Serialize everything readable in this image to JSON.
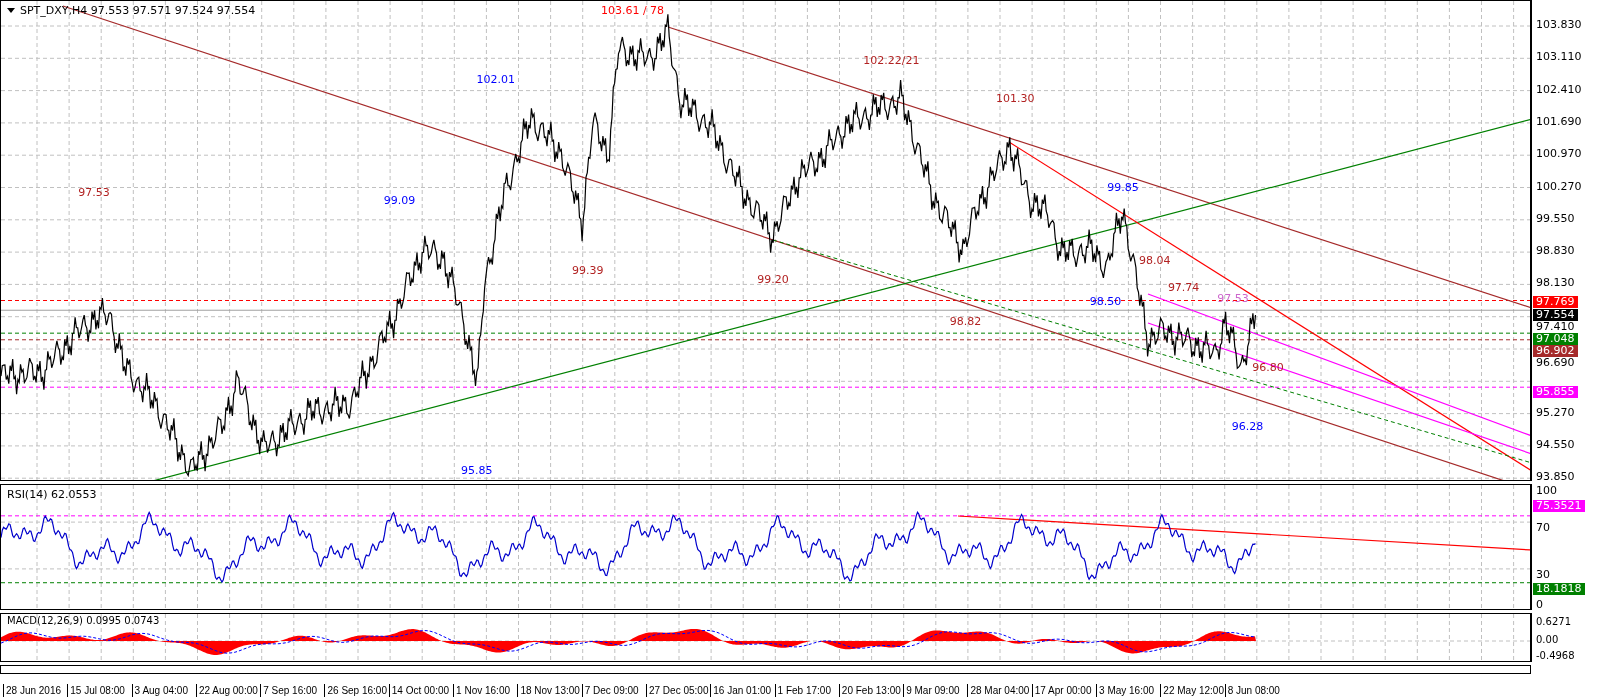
{
  "chart": {
    "title": "SPT_DXY,H4 97.553 97.571 97.524 97.554",
    "annotations": [
      {
        "text": "103.61 / 78",
        "color": "#ff0000"
      },
      {
        "text": "102.22/21",
        "color": "#b22222"
      },
      {
        "text": "102.01",
        "color": "#0000ff"
      },
      {
        "text": "101.30",
        "color": "#b22222"
      },
      {
        "text": "99.85",
        "color": "#0000ff"
      },
      {
        "text": "97.53",
        "color": "#b22222"
      },
      {
        "text": "99.09",
        "color": "#0000ff"
      },
      {
        "text": "98.04",
        "color": "#b22222"
      },
      {
        "text": "99.39",
        "color": "#b22222"
      },
      {
        "text": "99.20",
        "color": "#b22222"
      },
      {
        "text": "97.74",
        "color": "#b22222"
      },
      {
        "text": "97.53",
        "color": "#cc66cc"
      },
      {
        "text": "98.50",
        "color": "#0000ff"
      },
      {
        "text": "98.82",
        "color": "#b22222"
      },
      {
        "text": "96.80",
        "color": "#b22222"
      },
      {
        "text": "96.28",
        "color": "#0000ff"
      },
      {
        "text": "95.85",
        "color": "#0000ff"
      }
    ]
  },
  "price_axis": {
    "ticks": [
      "103.830",
      "103.110",
      "102.410",
      "101.690",
      "100.970",
      "100.270",
      "99.550",
      "98.830",
      "98.130",
      "97.410",
      "96.690",
      "95.270",
      "94.550",
      "93.850"
    ],
    "tags": [
      {
        "text": "97.769",
        "color": "#ff0000"
      },
      {
        "text": "97.554",
        "color": "#000000"
      },
      {
        "text": "97.048",
        "color": "#008000"
      },
      {
        "text": "96.902",
        "color": "#a52a2a"
      },
      {
        "text": "95.855",
        "color": "#ff00ff"
      }
    ]
  },
  "rsi": {
    "label": "RSI(14) 62.0553",
    "ticks": [
      "100",
      "70",
      "30",
      "0"
    ],
    "tags": [
      {
        "text": "75.3521",
        "color": "#ff00ff"
      },
      {
        "text": "18.1818",
        "color": "#008000"
      }
    ]
  },
  "macd": {
    "label": "MACD(12,26,9) 0.0995 0.0743",
    "ticks": [
      "0.6271",
      "0.00",
      "-0.4968"
    ]
  },
  "time_axis": {
    "labels": [
      "28 Jun 2016",
      "15 Jul 08:00",
      "3 Aug 04:00",
      "22 Aug 00:00",
      "7 Sep 16:00",
      "26 Sep 16:00",
      "14 Oct 00:00",
      "1 Nov 16:00",
      "18 Nov 13:00",
      "7 Dec 09:00",
      "27 Dec 05:00",
      "16 Jan 01:00",
      "1 Feb 17:00",
      "20 Feb 13:00",
      "9 Mar 09:00",
      "28 Mar 04:00",
      "17 Apr 00:00",
      "3 May 16:00",
      "22 May 12:00",
      "8 Jun 08:00"
    ]
  }
}
